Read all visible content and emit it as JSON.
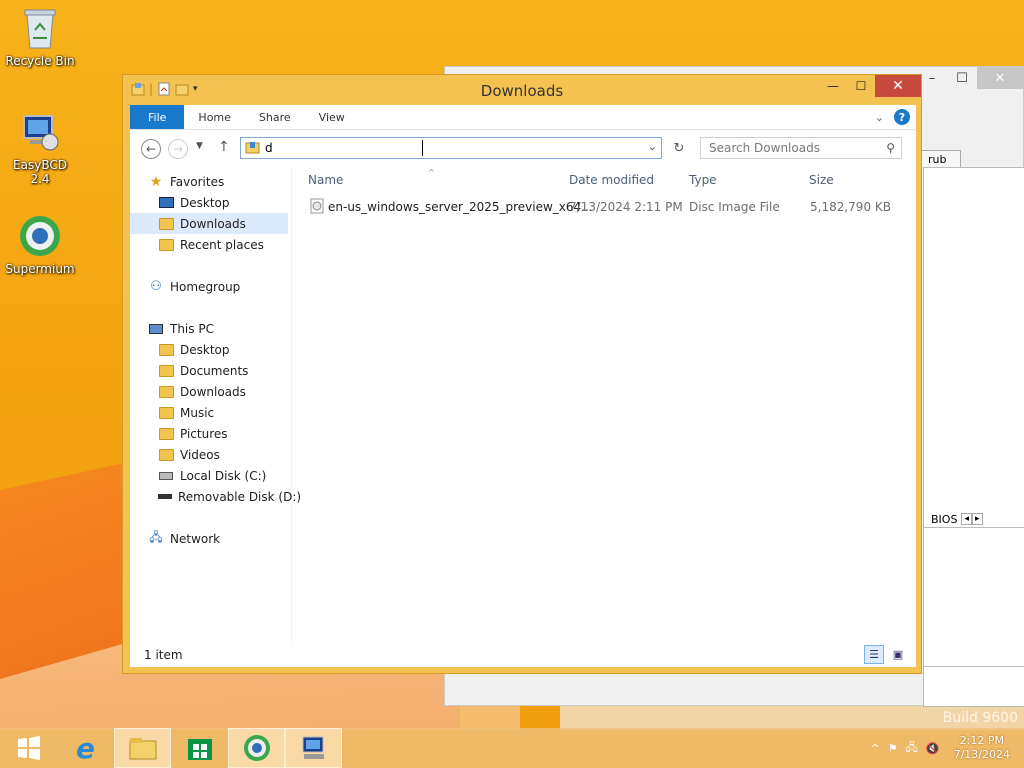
{
  "desktop": {
    "icons": [
      {
        "label": "Recycle Bin",
        "icon": "recycle-bin-icon"
      },
      {
        "label": "EasyBCD 2.4",
        "icon": "easybcd-icon"
      },
      {
        "label": "Supermium",
        "icon": "supermium-icon"
      }
    ],
    "build": "Build 9600"
  },
  "background_window": {
    "tab": "rub",
    "bios_label": "BIOS"
  },
  "explorer": {
    "title": "Downloads",
    "ribbon_tabs": [
      "File",
      "Home",
      "Share",
      "View"
    ],
    "address_value": "d",
    "search_placeholder": "Search Downloads",
    "nav": {
      "favorites": {
        "label": "Favorites",
        "items": [
          "Desktop",
          "Downloads",
          "Recent places"
        ]
      },
      "homegroup": "Homegroup",
      "this_pc": {
        "label": "This PC",
        "items": [
          "Desktop",
          "Documents",
          "Downloads",
          "Music",
          "Pictures",
          "Videos",
          "Local Disk (C:)",
          "Removable Disk (D:)"
        ]
      },
      "network": "Network",
      "selected": "Downloads"
    },
    "columns": [
      "Name",
      "Date modified",
      "Type",
      "Size"
    ],
    "files": [
      {
        "name": "en-us_windows_server_2025_preview_x64...",
        "date": "7/13/2024 2:11 PM",
        "type": "Disc Image File",
        "size": "5,182,790 KB"
      }
    ],
    "status": "1 item"
  },
  "taskbar": {
    "time": "2:12 PM",
    "date": "7/13/2024"
  },
  "colors": {
    "accent": "#1979ca",
    "frame": "#f3c251",
    "close": "#c74a3e"
  }
}
